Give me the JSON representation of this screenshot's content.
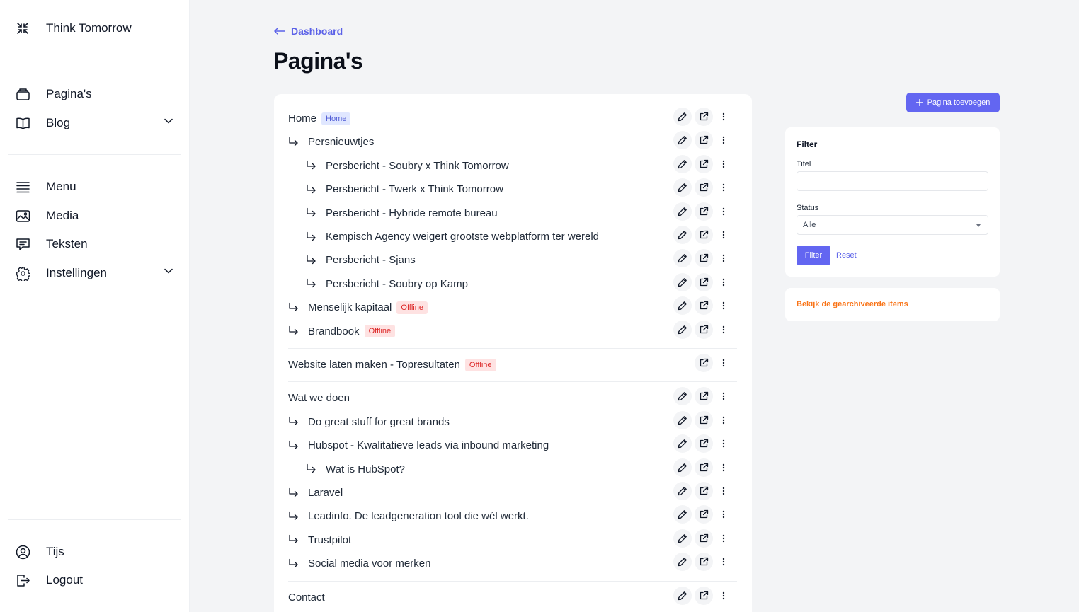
{
  "sidebar": {
    "brand": "Think Tomorrow",
    "nav_group1": [
      {
        "label": "Pagina's",
        "icon": "pages-icon"
      },
      {
        "label": "Blog",
        "icon": "book-icon",
        "expandable": true
      }
    ],
    "nav_group2": [
      {
        "label": "Menu",
        "icon": "menu-icon"
      },
      {
        "label": "Media",
        "icon": "image-icon"
      },
      {
        "label": "Teksten",
        "icon": "chat-icon"
      },
      {
        "label": "Instellingen",
        "icon": "gear-icon",
        "expandable": true
      }
    ],
    "user": {
      "label": "Tijs",
      "icon": "user-icon"
    },
    "logout": {
      "label": "Logout",
      "icon": "logout-icon"
    }
  },
  "header": {
    "back_label": "Dashboard",
    "title": "Pagina's"
  },
  "pages": {
    "group1": [
      {
        "label": "Home",
        "level": 0,
        "badge": "Home"
      },
      {
        "label": "Persnieuwtjes",
        "level": 1
      },
      {
        "label": "Persbericht - Soubry x Think Tomorrow",
        "level": 2
      },
      {
        "label": "Persbericht - Twerk x Think Tomorrow",
        "level": 2
      },
      {
        "label": "Persbericht - Hybride remote bureau",
        "level": 2
      },
      {
        "label": "Kempisch Agency weigert grootste webplatform ter wereld",
        "level": 2
      },
      {
        "label": "Persbericht - Sjans",
        "level": 2
      },
      {
        "label": "Persbericht - Soubry op Kamp",
        "level": 2
      },
      {
        "label": "Menselijk kapitaal",
        "level": 1,
        "badge": "Offline"
      },
      {
        "label": "Brandbook",
        "level": 1,
        "badge": "Offline"
      }
    ],
    "group2": [
      {
        "label": "Website laten maken - Topresultaten",
        "level": 0,
        "badge": "Offline",
        "no_edit": true
      }
    ],
    "group3": [
      {
        "label": "Wat we doen",
        "level": 0
      },
      {
        "label": "Do great stuff for great brands",
        "level": 1
      },
      {
        "label": "Hubspot - Kwalitatieve leads via inbound marketing",
        "level": 1
      },
      {
        "label": "Wat is HubSpot?",
        "level": 2
      },
      {
        "label": "Laravel",
        "level": 1
      },
      {
        "label": "Leadinfo. De leadgeneration tool die wél werkt.",
        "level": 1
      },
      {
        "label": "Trustpilot",
        "level": 1
      },
      {
        "label": "Social media voor merken",
        "level": 1
      }
    ],
    "group4": [
      {
        "label": "Contact",
        "level": 0
      }
    ]
  },
  "actions": {
    "add_page": "Pagina toevoegen"
  },
  "filter": {
    "title": "Filter",
    "title_label": "Titel",
    "title_value": "",
    "status_label": "Status",
    "status_value": "Alle",
    "filter_button": "Filter",
    "reset_link": "Reset"
  },
  "archive": {
    "link": "Bekijk de gearchiveerde items"
  },
  "colors": {
    "accent": "#6366f1",
    "offline_badge_bg": "#fee2e2",
    "offline_badge_text": "#dc2626",
    "home_badge_bg": "#e0e7ff",
    "archive_link": "#f97316"
  }
}
